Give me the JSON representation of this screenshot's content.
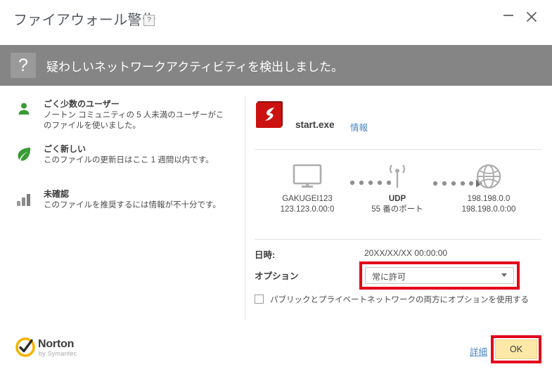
{
  "window": {
    "title": "ファイアウォール警告",
    "help_icon_label": "?",
    "minimize_label": "minimize",
    "close_label": "close"
  },
  "banner": {
    "icon_label": "?",
    "message": "疑わしいネットワークアクティビティを検出しました。"
  },
  "reputation": {
    "items": [
      {
        "icon": "person-icon",
        "title": "ごく少数のユーザー",
        "description": "ノートン コミュニティの 5 人未満のユーザーがこのファイルを使いました。",
        "color": "#3a9b35"
      },
      {
        "icon": "leaf-icon",
        "title": "ごく新しい",
        "description": "このファイルの更新日はここ 1 週間以内です。",
        "color": "#3a9b35"
      },
      {
        "icon": "bar-chart-icon",
        "title": "未確認",
        "description": "このファイルを推奨するには情報が不十分です。",
        "color": "#8c8c8c"
      }
    ]
  },
  "detail": {
    "file": {
      "icon": "flash-file-icon",
      "name": "start.exe",
      "info_link": "情報"
    },
    "flow": {
      "local": {
        "icon": "monitor-icon",
        "line1": "GAKUGEI123",
        "line2": "123.123.0.00:0"
      },
      "protocol": {
        "icon": "antenna-icon",
        "line1": "UDP",
        "line2": "55 番のポート"
      },
      "remote": {
        "icon": "globe-icon",
        "line1": "198.198.0.0",
        "line2": "198.198.0.0:00"
      }
    },
    "date": {
      "label": "日時:",
      "value": "20XX/XX/XX 00:00:00"
    },
    "option": {
      "label": "オプション",
      "selected": "常に許可",
      "options": [
        "常に許可"
      ]
    },
    "checkbox": {
      "label": "パブリックとプライベートネットワークの両方にオプションを使用する",
      "checked": false
    }
  },
  "footer": {
    "brand_name": "Norton",
    "brand_sub": "by Symantec",
    "detail_link": "詳細",
    "ok_button": "OK"
  },
  "colors": {
    "highlight": "#e3001b",
    "banner_bg": "#858585",
    "link": "#4a87c4",
    "ok_bg": "#fde8a8",
    "green": "#3a9b35",
    "gray": "#8c8c8c",
    "flash_red": "#cc1111"
  }
}
